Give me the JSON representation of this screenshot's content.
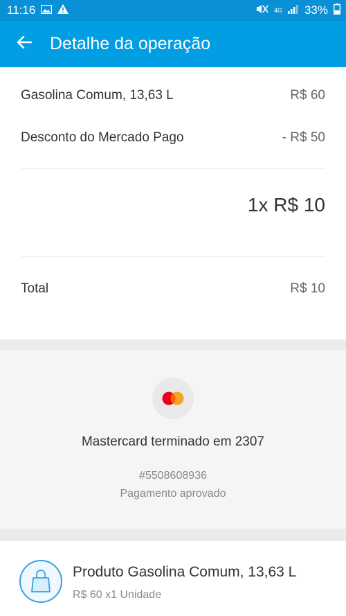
{
  "status_bar": {
    "time": "11:16",
    "battery": "33%",
    "network": "4G"
  },
  "header": {
    "title": "Detalhe da operação",
    "back_icon": "arrow-left-icon"
  },
  "summary": {
    "item_label": "Gasolina Comum, 13,63 L",
    "item_amount": "R$ 60",
    "discount_label": "Desconto do Mercado Pago",
    "discount_amount": "- R$ 50",
    "installments": "1x R$ 10",
    "total_label": "Total",
    "total_amount": "R$ 10"
  },
  "payment": {
    "card_icon": "mastercard-logo",
    "card_name": "Mastercard terminado em 2307",
    "operation_id": "#5508608936",
    "status": "Pagamento aprovado"
  },
  "product": {
    "icon": "shopping-bag-icon",
    "title": "Produto Gasolina Comum, 13,63 L",
    "subtitle": "R$ 60 x1 Unidade"
  },
  "colors": {
    "status_bar": "#0a90d6",
    "app_bar": "#019ee3",
    "mastercard_red": "#eb001b",
    "mastercard_orange": "#f79e1b"
  }
}
